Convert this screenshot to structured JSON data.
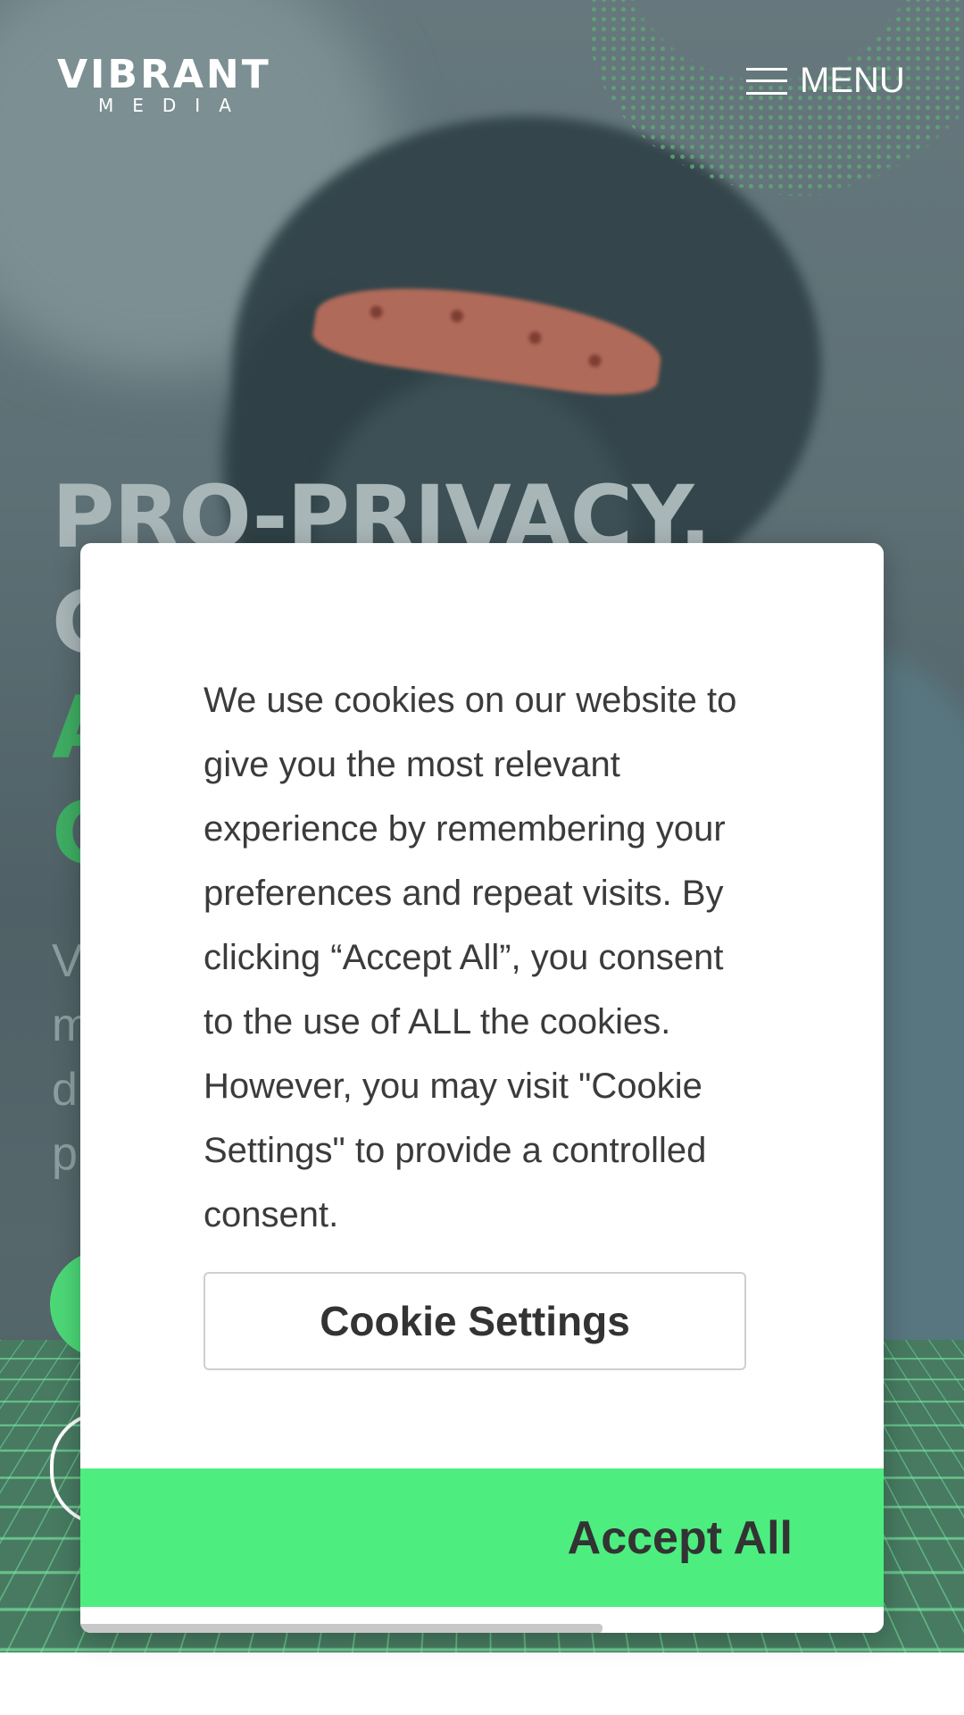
{
  "header": {
    "logo_main": "VIBRANT",
    "logo_sub": "MEDIA",
    "menu_label": "MENU"
  },
  "hero": {
    "title_lines": [
      "PRO-PRIVACY,",
      "C",
      "A",
      "C"
    ],
    "subtitle_lines": [
      "V",
      "m",
      "d",
      "p"
    ]
  },
  "cookie_modal": {
    "message": "We use cookies on our website to give you the most relevant experience by remembering your preferences and repeat visits. By clicking “Accept All”, you consent to the use of ALL the cookies. However, you may visit \"Cookie Settings\" to provide a controlled consent.",
    "settings_label": "Cookie Settings",
    "accept_label": "Accept All",
    "scroll_position": 0.65
  },
  "colors": {
    "accent_green": "#4dee7f",
    "hero_overlay": "#5d7075",
    "text_dark": "#333333"
  },
  "icons": {
    "menu": "hamburger-icon"
  }
}
